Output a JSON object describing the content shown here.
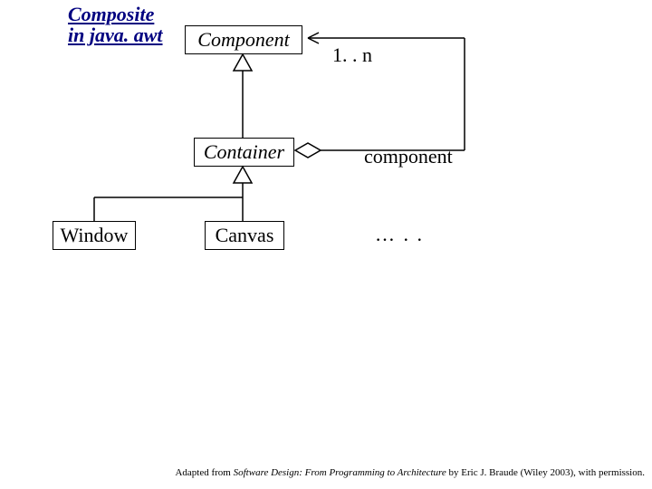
{
  "title": "Composite in java. awt",
  "nodes": {
    "component": "Component",
    "container": "Container",
    "window": "Window",
    "canvas": "Canvas"
  },
  "labels": {
    "multiplicity": "1. . n",
    "role": "component",
    "dots": "… . ."
  },
  "attribution": {
    "prefix": "Adapted from ",
    "book": "Software Design: From Programming to Architecture",
    "suffix": " by Eric J. Braude (Wiley 2003), with permission."
  },
  "chart_data": {
    "type": "uml-class-diagram",
    "title": "Composite in java.awt",
    "classes": [
      {
        "name": "Component",
        "abstract": true
      },
      {
        "name": "Container",
        "abstract": true
      },
      {
        "name": "Window",
        "abstract": false
      },
      {
        "name": "Canvas",
        "abstract": false
      }
    ],
    "generalizations": [
      {
        "child": "Container",
        "parent": "Component"
      },
      {
        "child": "Window",
        "parent": "Container"
      },
      {
        "child": "Canvas",
        "parent": "Container"
      }
    ],
    "aggregations": [
      {
        "whole": "Container",
        "part": "Component",
        "multiplicity": "1..n",
        "role": "component"
      }
    ],
    "ellipsis_siblings_of": "Container"
  }
}
